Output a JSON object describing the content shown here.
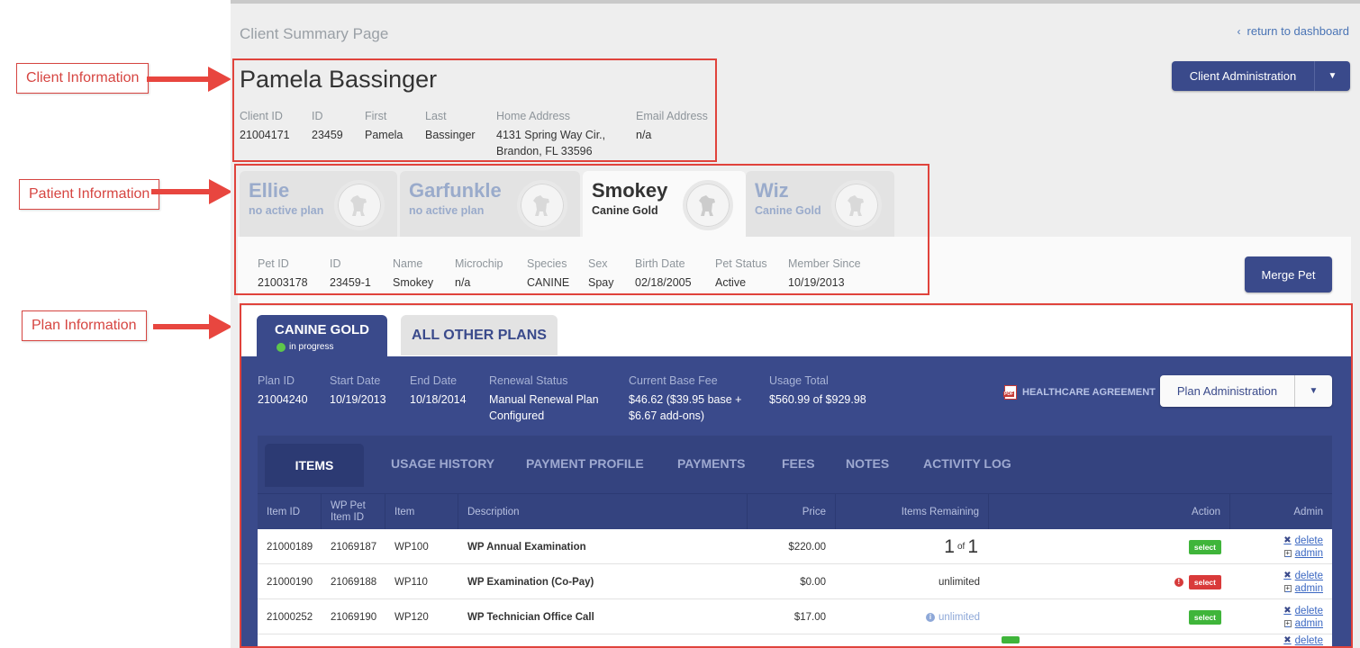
{
  "annotations": {
    "client": "Client Information",
    "patient": "Patient Information",
    "plan": "Plan Information"
  },
  "page": {
    "title": "Client Summary Page",
    "return_link": "return to dashboard",
    "return_chevron": "‹"
  },
  "client": {
    "name": "Pamela Bassinger",
    "admin_button": "Client Administration",
    "fields": [
      {
        "label": "Client ID",
        "value": "21004171"
      },
      {
        "label": "ID",
        "value": "23459"
      },
      {
        "label": "First",
        "value": "Pamela"
      },
      {
        "label": "Last",
        "value": "Bassinger"
      },
      {
        "label": "Home Address",
        "value": "4131 Spring Way Cir.,",
        "value2": "Brandon, FL 33596"
      },
      {
        "label": "Email Address",
        "value": "n/a"
      }
    ]
  },
  "pets": [
    {
      "name": "Ellie",
      "plan": "no active plan",
      "active": false
    },
    {
      "name": "Garfunkle",
      "plan": "no active plan",
      "active": false
    },
    {
      "name": "Smokey",
      "plan": "Canine Gold",
      "active": true
    },
    {
      "name": "Wiz",
      "plan": "Canine Gold",
      "active": false
    }
  ],
  "pet_details": {
    "merge_button": "Merge Pet",
    "fields": [
      {
        "label": "Pet ID",
        "value": "21003178"
      },
      {
        "label": "ID",
        "value": "23459-1"
      },
      {
        "label": "Name",
        "value": "Smokey"
      },
      {
        "label": "Microchip",
        "value": "n/a"
      },
      {
        "label": "Species",
        "value": "CANINE"
      },
      {
        "label": "Sex",
        "value": "Spay"
      },
      {
        "label": "Birth Date",
        "value": "02/18/2005"
      },
      {
        "label": "Pet Status",
        "value": "Active"
      },
      {
        "label": "Member Since",
        "value": "10/19/2013"
      }
    ]
  },
  "plan_tabs": {
    "active_name": "CANINE GOLD",
    "active_status": "in progress",
    "other": "ALL OTHER PLANS"
  },
  "plan": {
    "fields": [
      {
        "label": "Plan ID",
        "value": "21004240"
      },
      {
        "label": "Start Date",
        "value": "10/19/2013"
      },
      {
        "label": "End Date",
        "value": "10/18/2014"
      },
      {
        "label": "Renewal Status",
        "value": "Manual Renewal Plan",
        "value2": "Configured"
      },
      {
        "label": "Current Base Fee",
        "value": "$46.62 ($39.95 base +",
        "value2": "$6.67 add-ons)"
      },
      {
        "label": "Usage Total",
        "value": "$560.99 of $929.98"
      }
    ],
    "healthcare_agreement": "HEALTHCARE AGREEMENT",
    "pdf_label": "PDF",
    "admin_button": "Plan Administration"
  },
  "sub_tabs": [
    "ITEMS",
    "USAGE HISTORY",
    "PAYMENT PROFILE",
    "PAYMENTS",
    "FEES",
    "NOTES",
    "ACTIVITY LOG"
  ],
  "table": {
    "headers": {
      "item_id": "Item ID",
      "wp_pet_item_id_1": "WP Pet",
      "wp_pet_item_id_2": "Item ID",
      "item": "Item",
      "description": "Description",
      "price": "Price",
      "remaining": "Items Remaining",
      "action": "Action",
      "admin": "Admin"
    },
    "rows": [
      {
        "item_id": "21000189",
        "wp_id": "21069187",
        "item": "WP100",
        "description": "WP Annual Examination",
        "price": "$220.00",
        "remaining_a": "1",
        "remaining_of": "of",
        "remaining_b": "1",
        "action": "select",
        "delete": "delete",
        "admin": "admin"
      },
      {
        "item_id": "21000190",
        "wp_id": "21069188",
        "item": "WP110",
        "description": "WP Examination (Co-Pay)",
        "price": "$0.00",
        "remaining": "unlimited",
        "action": "select",
        "delete": "delete",
        "admin": "admin"
      },
      {
        "item_id": "21000252",
        "wp_id": "21069190",
        "item": "WP120",
        "description": "WP Technician Office Call",
        "price": "$17.00",
        "remaining": "unlimited",
        "action": "select",
        "delete": "delete",
        "admin": "admin"
      }
    ],
    "partial_row_delete": "delete"
  },
  "colors": {
    "brand_navy": "#3a4a8b",
    "highlight_red": "#e0433c",
    "select_green": "#3fb53a",
    "select_red": "#d93a3a"
  },
  "icons": [
    "chevron-left-icon",
    "caret-down-icon",
    "dog-silhouette-icon",
    "pdf-icon",
    "info-icon",
    "warning-icon",
    "delete-x-icon",
    "expand-box-icon"
  ]
}
